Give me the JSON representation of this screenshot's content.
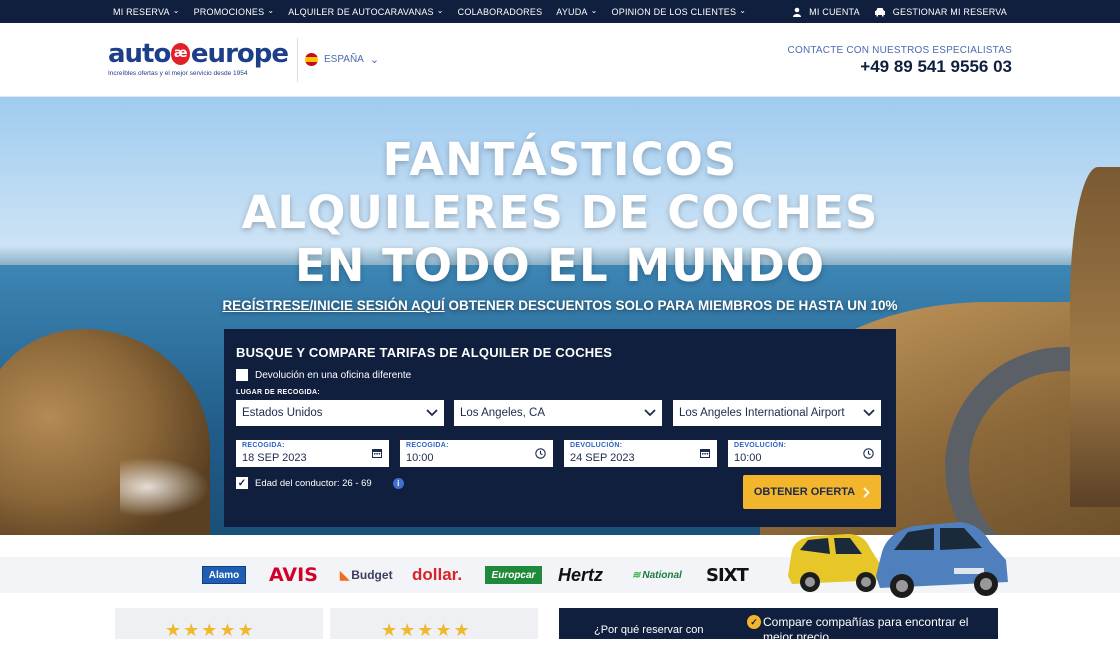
{
  "topnav": {
    "items": [
      "MI RESERVA",
      "PROMOCIONES",
      "ALQUILER DE AUTOCARAVANAS",
      "COLABORADORES",
      "AYUDA",
      "OPINION DE LOS CLIENTES"
    ],
    "account": "MI CUENTA",
    "manage": "GESTIONAR MI RESERVA"
  },
  "header": {
    "logo_left": "auto",
    "logo_mark": "æ",
    "logo_right": "europe",
    "tagline": "Increíbles ofertas y el mejor servicio desde 1954",
    "country": "ESPAÑA",
    "contact_label": "CONTACTE CON NUESTROS ESPECIALISTAS",
    "phone": "+49 89 541 9556 03"
  },
  "hero": {
    "line1": "FANTÁSTICOS",
    "line2": "ALQUILERES DE COCHES",
    "line3": "EN TODO EL MUNDO",
    "promo_link": "REGÍSTRESE/INICIE SESIÓN AQUÍ",
    "promo_text": " OBTENER DESCUENTOS SOLO PARA MIEMBROS DE HASTA UN 10%"
  },
  "search": {
    "title": "BUSQUE Y COMPARE TARIFAS DE ALQUILER DE COCHES",
    "different_office": "Devolución en una oficina diferente",
    "pickup_label": "LUGAR DE RECOGIDA:",
    "country": "Estados Unidos",
    "city": "Los Angeles, CA",
    "location": "Los Angeles International Airport",
    "pickup_date_label": "RECOGIDA:",
    "pickup_date": "18 SEP 2023",
    "pickup_time_label": "RECOGIDA:",
    "pickup_time": "10:00",
    "return_date_label": "DEVOLUCIÓN:",
    "return_date": "24 SEP 2023",
    "return_time_label": "DEVOLUCIÓN:",
    "return_time": "10:00",
    "driver_age": "Edad del conductor: 26 - 69",
    "cta": "OBTENER OFERTA"
  },
  "brands": [
    "Alamo",
    "AVIS",
    "Budget",
    "dollar.",
    "Europcar",
    "Hertz",
    "National",
    "SIXT"
  ],
  "bottom": {
    "why_text": "¿Por qué reservar con",
    "benefit": "Compare compañías para encontrar el mejor precio"
  },
  "colors": {
    "navy": "#0f1f3d",
    "accent": "#f3b52b",
    "link_blue": "#4b6bb0"
  }
}
